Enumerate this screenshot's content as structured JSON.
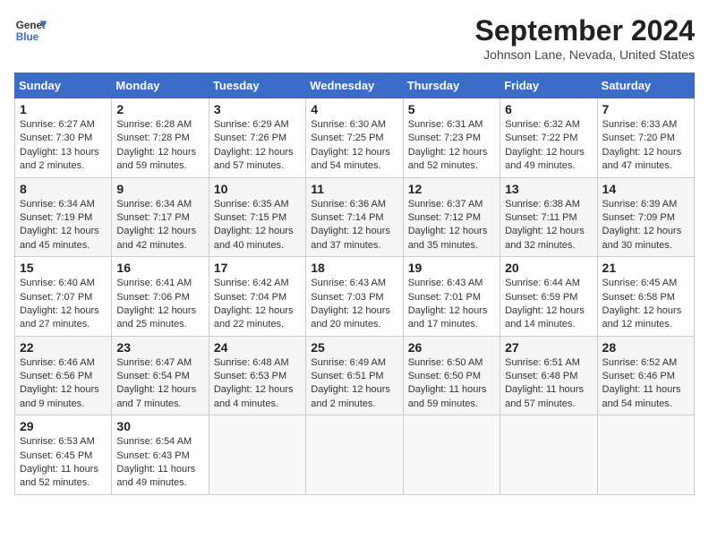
{
  "header": {
    "logo_line1": "General",
    "logo_line2": "Blue",
    "title": "September 2024",
    "location": "Johnson Lane, Nevada, United States"
  },
  "weekdays": [
    "Sunday",
    "Monday",
    "Tuesday",
    "Wednesday",
    "Thursday",
    "Friday",
    "Saturday"
  ],
  "weeks": [
    [
      {
        "day": "1",
        "info": "Sunrise: 6:27 AM\nSunset: 7:30 PM\nDaylight: 13 hours\nand 2 minutes."
      },
      {
        "day": "2",
        "info": "Sunrise: 6:28 AM\nSunset: 7:28 PM\nDaylight: 12 hours\nand 59 minutes."
      },
      {
        "day": "3",
        "info": "Sunrise: 6:29 AM\nSunset: 7:26 PM\nDaylight: 12 hours\nand 57 minutes."
      },
      {
        "day": "4",
        "info": "Sunrise: 6:30 AM\nSunset: 7:25 PM\nDaylight: 12 hours\nand 54 minutes."
      },
      {
        "day": "5",
        "info": "Sunrise: 6:31 AM\nSunset: 7:23 PM\nDaylight: 12 hours\nand 52 minutes."
      },
      {
        "day": "6",
        "info": "Sunrise: 6:32 AM\nSunset: 7:22 PM\nDaylight: 12 hours\nand 49 minutes."
      },
      {
        "day": "7",
        "info": "Sunrise: 6:33 AM\nSunset: 7:20 PM\nDaylight: 12 hours\nand 47 minutes."
      }
    ],
    [
      {
        "day": "8",
        "info": "Sunrise: 6:34 AM\nSunset: 7:19 PM\nDaylight: 12 hours\nand 45 minutes."
      },
      {
        "day": "9",
        "info": "Sunrise: 6:34 AM\nSunset: 7:17 PM\nDaylight: 12 hours\nand 42 minutes."
      },
      {
        "day": "10",
        "info": "Sunrise: 6:35 AM\nSunset: 7:15 PM\nDaylight: 12 hours\nand 40 minutes."
      },
      {
        "day": "11",
        "info": "Sunrise: 6:36 AM\nSunset: 7:14 PM\nDaylight: 12 hours\nand 37 minutes."
      },
      {
        "day": "12",
        "info": "Sunrise: 6:37 AM\nSunset: 7:12 PM\nDaylight: 12 hours\nand 35 minutes."
      },
      {
        "day": "13",
        "info": "Sunrise: 6:38 AM\nSunset: 7:11 PM\nDaylight: 12 hours\nand 32 minutes."
      },
      {
        "day": "14",
        "info": "Sunrise: 6:39 AM\nSunset: 7:09 PM\nDaylight: 12 hours\nand 30 minutes."
      }
    ],
    [
      {
        "day": "15",
        "info": "Sunrise: 6:40 AM\nSunset: 7:07 PM\nDaylight: 12 hours\nand 27 minutes."
      },
      {
        "day": "16",
        "info": "Sunrise: 6:41 AM\nSunset: 7:06 PM\nDaylight: 12 hours\nand 25 minutes."
      },
      {
        "day": "17",
        "info": "Sunrise: 6:42 AM\nSunset: 7:04 PM\nDaylight: 12 hours\nand 22 minutes."
      },
      {
        "day": "18",
        "info": "Sunrise: 6:43 AM\nSunset: 7:03 PM\nDaylight: 12 hours\nand 20 minutes."
      },
      {
        "day": "19",
        "info": "Sunrise: 6:43 AM\nSunset: 7:01 PM\nDaylight: 12 hours\nand 17 minutes."
      },
      {
        "day": "20",
        "info": "Sunrise: 6:44 AM\nSunset: 6:59 PM\nDaylight: 12 hours\nand 14 minutes."
      },
      {
        "day": "21",
        "info": "Sunrise: 6:45 AM\nSunset: 6:58 PM\nDaylight: 12 hours\nand 12 minutes."
      }
    ],
    [
      {
        "day": "22",
        "info": "Sunrise: 6:46 AM\nSunset: 6:56 PM\nDaylight: 12 hours\nand 9 minutes."
      },
      {
        "day": "23",
        "info": "Sunrise: 6:47 AM\nSunset: 6:54 PM\nDaylight: 12 hours\nand 7 minutes."
      },
      {
        "day": "24",
        "info": "Sunrise: 6:48 AM\nSunset: 6:53 PM\nDaylight: 12 hours\nand 4 minutes."
      },
      {
        "day": "25",
        "info": "Sunrise: 6:49 AM\nSunset: 6:51 PM\nDaylight: 12 hours\nand 2 minutes."
      },
      {
        "day": "26",
        "info": "Sunrise: 6:50 AM\nSunset: 6:50 PM\nDaylight: 11 hours\nand 59 minutes."
      },
      {
        "day": "27",
        "info": "Sunrise: 6:51 AM\nSunset: 6:48 PM\nDaylight: 11 hours\nand 57 minutes."
      },
      {
        "day": "28",
        "info": "Sunrise: 6:52 AM\nSunset: 6:46 PM\nDaylight: 11 hours\nand 54 minutes."
      }
    ],
    [
      {
        "day": "29",
        "info": "Sunrise: 6:53 AM\nSunset: 6:45 PM\nDaylight: 11 hours\nand 52 minutes."
      },
      {
        "day": "30",
        "info": "Sunrise: 6:54 AM\nSunset: 6:43 PM\nDaylight: 11 hours\nand 49 minutes."
      },
      {
        "day": "",
        "info": ""
      },
      {
        "day": "",
        "info": ""
      },
      {
        "day": "",
        "info": ""
      },
      {
        "day": "",
        "info": ""
      },
      {
        "day": "",
        "info": ""
      }
    ]
  ]
}
